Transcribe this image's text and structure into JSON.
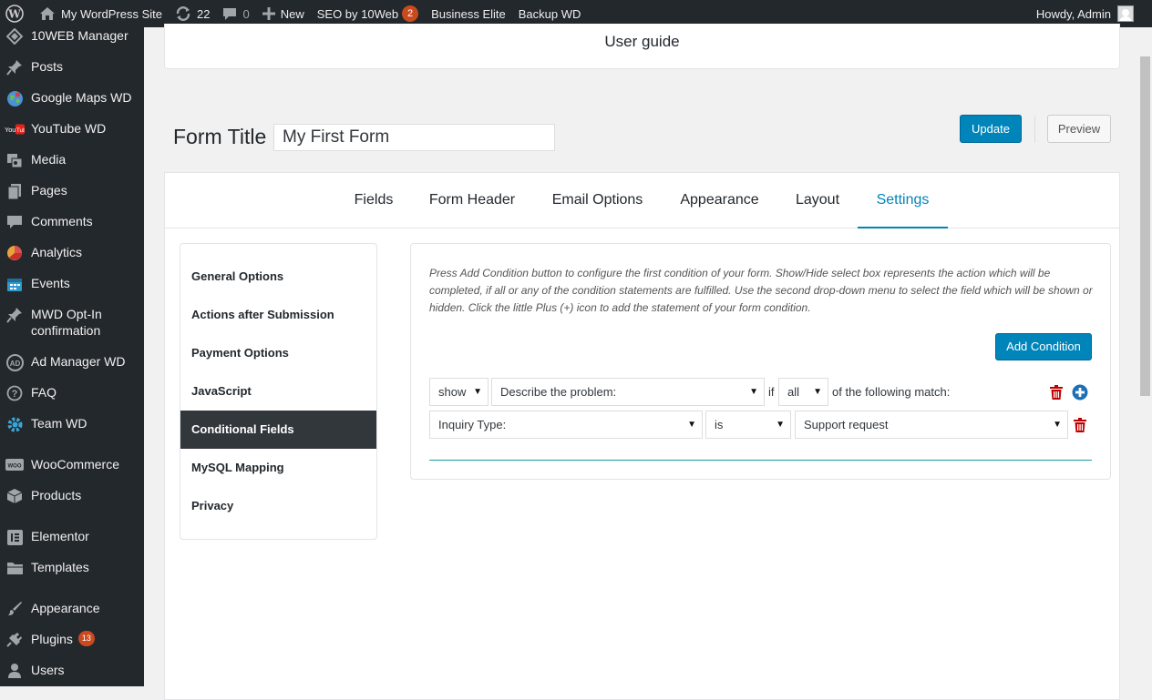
{
  "admin_bar": {
    "site_name": "My WordPress Site",
    "updates_count": "22",
    "comments_count": "0",
    "new_label": "New",
    "seo_label": "SEO by 10Web",
    "seo_badge": "2",
    "business_label": "Business Elite",
    "backup_label": "Backup WD",
    "howdy": "Howdy, Admin"
  },
  "sidebar": {
    "items": [
      {
        "label": "10WEB Manager",
        "icon": "tenweb-icon"
      },
      {
        "label": "Posts",
        "icon": "pin-icon"
      },
      {
        "label": "Google Maps WD",
        "icon": "globe-icon"
      },
      {
        "label": "YouTube WD",
        "icon": "youtube-icon"
      },
      {
        "label": "Media",
        "icon": "media-icon"
      },
      {
        "label": "Pages",
        "icon": "pages-icon"
      },
      {
        "label": "Comments",
        "icon": "comment-icon"
      },
      {
        "label": "Analytics",
        "icon": "analytics-icon"
      },
      {
        "label": "Events",
        "icon": "calendar-icon"
      },
      {
        "label": "MWD Opt-In confirmation",
        "icon": "pin-icon"
      },
      {
        "label": "Ad Manager WD",
        "icon": "ad-icon"
      },
      {
        "label": "FAQ",
        "icon": "question-icon"
      },
      {
        "label": "Team WD",
        "icon": "gear-icon"
      },
      {
        "label": "WooCommerce",
        "icon": "woo-icon"
      },
      {
        "label": "Products",
        "icon": "box-icon"
      },
      {
        "label": "Elementor",
        "icon": "elementor-icon"
      },
      {
        "label": "Templates",
        "icon": "folder-icon"
      },
      {
        "label": "Appearance",
        "icon": "brush-icon"
      },
      {
        "label": "Plugins",
        "icon": "plug-icon",
        "badge": "13"
      },
      {
        "label": "Users",
        "icon": "user-icon"
      }
    ]
  },
  "user_guide": "User guide",
  "form": {
    "title_label": "Form Title",
    "title_value": "My First Form",
    "update_label": "Update",
    "preview_label": "Preview"
  },
  "tabs": [
    "Fields",
    "Form Header",
    "Email Options",
    "Appearance",
    "Layout",
    "Settings"
  ],
  "active_tab": "Settings",
  "settings_nav": [
    "General Options",
    "Actions after Submission",
    "Payment Options",
    "JavaScript",
    "Conditional Fields",
    "MySQL Mapping",
    "Privacy"
  ],
  "active_settings_nav": "Conditional Fields",
  "conditional": {
    "description": "Press Add Condition button to configure the first condition of your form. Show/Hide select box represents the action which will be completed, if all or any of the condition statements are fulfilled. Use the second drop-down menu to select the field which will be shown or hidden. Click the little Plus (+) icon to add the statement of your form condition.",
    "add_condition_label": "Add Condition",
    "action_select": "show",
    "field_select": "Describe the problem:",
    "if_text": "if",
    "match_select": "all",
    "match_text": "of the following match:",
    "statement": {
      "field": "Inquiry Type:",
      "operator": "is",
      "value": "Support request"
    }
  },
  "colors": {
    "primary": "#0085ba",
    "admin_bar": "#23282d",
    "badge": "#ca4a1f",
    "delete": "#c00000",
    "teal_line": "#1b9aa2"
  }
}
